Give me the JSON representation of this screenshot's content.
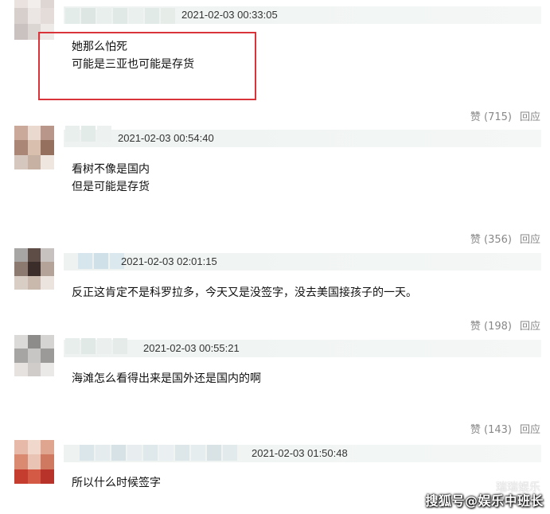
{
  "comments": [
    {
      "timestamp": "2021-02-03 00:33:05",
      "lines": [
        "她那么怕死",
        "可能是三亚也可能是存货"
      ],
      "like_label": "赞 (715)",
      "reply_label": "回应"
    },
    {
      "timestamp": "2021-02-03 00:54:40",
      "lines": [
        "看树不像是国内",
        "但是可能是存货"
      ],
      "like_label": "赞 (356)",
      "reply_label": "回应"
    },
    {
      "timestamp": "2021-02-03 02:01:15",
      "lines": [
        "反正这肯定不是科罗拉多，今天又是没签字，没去美国接孩子的一天。"
      ],
      "like_label": "赞 (198)",
      "reply_label": "回应"
    },
    {
      "timestamp": "2021-02-03 00:55:21",
      "lines": [
        "海滩怎么看得出来是国外还是国内的啊"
      ],
      "like_label": "赞 (143)",
      "reply_label": "回应"
    },
    {
      "timestamp": "2021-02-03 01:50:48",
      "lines": [
        "所以什么时候签字"
      ]
    }
  ],
  "watermark": {
    "text": "搜狐号@娱乐中班长",
    "faint_text": "瑞瑞娱乐"
  },
  "colors": {
    "highlight_border": "#d9343a",
    "header_bar": "#eef3f1",
    "action_text": "#888888"
  }
}
